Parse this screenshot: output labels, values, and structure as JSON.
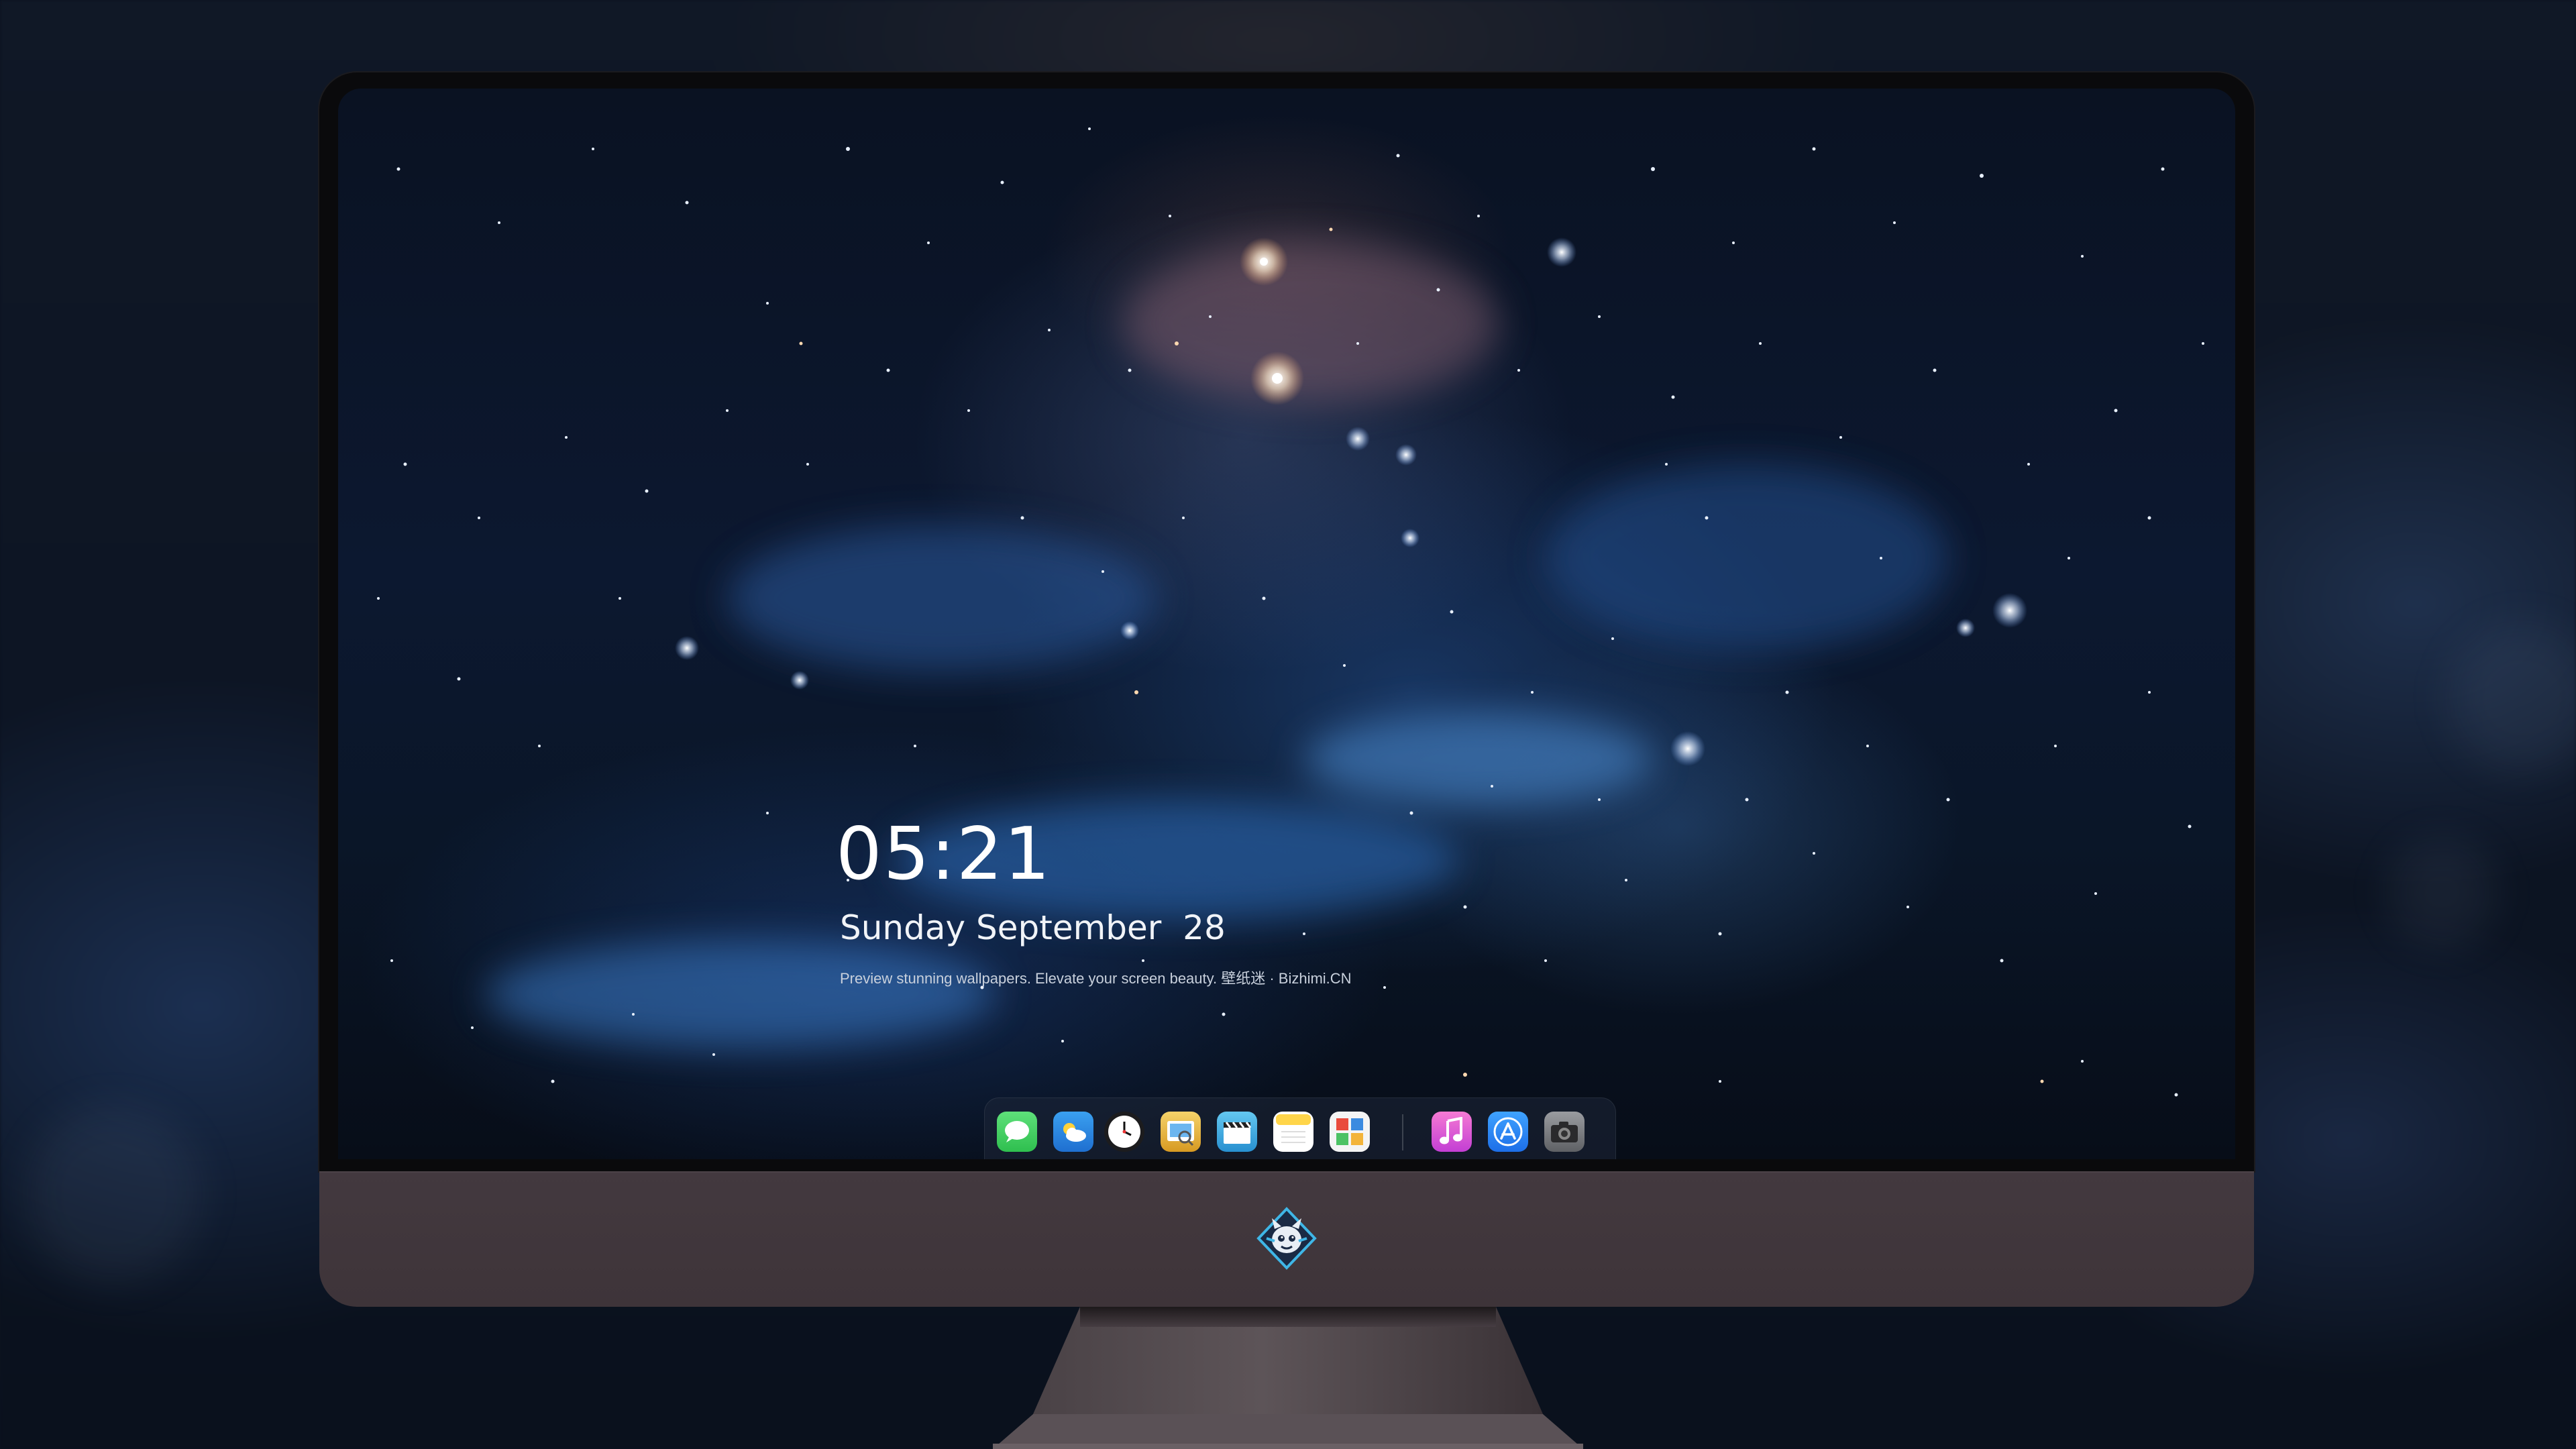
{
  "lock_screen": {
    "time": "05:21",
    "date": "Sunday September  28",
    "caption": "Preview stunning wallpapers. Elevate your screen beauty. 壁纸迷 · Bizhimi.CN"
  },
  "dock": {
    "apps": [
      {
        "name": "messages-icon",
        "color": "#34c759"
      },
      {
        "name": "weather-icon",
        "color": "#2f8fe8"
      },
      {
        "name": "clock-icon",
        "color": "#1c1c1e"
      },
      {
        "name": "preview-icon",
        "color": "#e9b23a"
      },
      {
        "name": "clapperboard-icon",
        "color": "#3aa4d8"
      },
      {
        "name": "notes-icon",
        "color": "#ffd54a"
      },
      {
        "name": "photo-booth-icon",
        "color": "#f2f2f2"
      },
      {
        "name": "music-icon",
        "color": "#e84fb5"
      },
      {
        "name": "app-store-icon",
        "color": "#1e7cf2"
      },
      {
        "name": "camera-icon",
        "color": "#7b7d80"
      }
    ]
  },
  "monitor": {
    "logo": "monster-badge-icon"
  }
}
